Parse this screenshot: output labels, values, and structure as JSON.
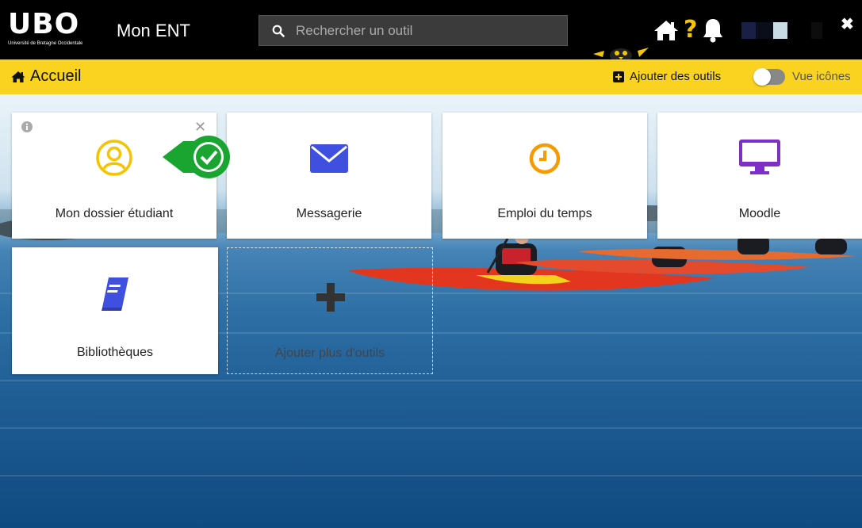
{
  "header": {
    "logo_text": "UBO",
    "logo_subtitle": "Université de Bretagne Occidentale",
    "app_title": "Mon ENT",
    "search_placeholder": "Rechercher un outil",
    "close_symbol": "✖"
  },
  "breadcrumb": {
    "label": "Accueil"
  },
  "toolbar": {
    "add_tools_label": "Ajouter des outils",
    "view_toggle_label": "Vue icônes",
    "view_toggle_on": false
  },
  "tiles": [
    {
      "label": "Mon dossier étudiant",
      "icon": "user-circle-icon",
      "color": "#f5c400"
    },
    {
      "label": "Messagerie",
      "icon": "envelope-icon",
      "color": "#3f4fe0"
    },
    {
      "label": "Emploi du temps",
      "icon": "clock-icon",
      "color": "#f59a00"
    },
    {
      "label": "Moodle",
      "icon": "desktop-icon",
      "color": "#7d2fc7"
    },
    {
      "label": "Bibliothèques",
      "icon": "book-icon",
      "color": "#3f4fe0"
    }
  ],
  "add_tile": {
    "label": "Ajouter plus d'outils"
  },
  "colors": {
    "topbar": "#000000",
    "accent_yellow": "#f9d31f",
    "check_green": "#1aa531"
  }
}
